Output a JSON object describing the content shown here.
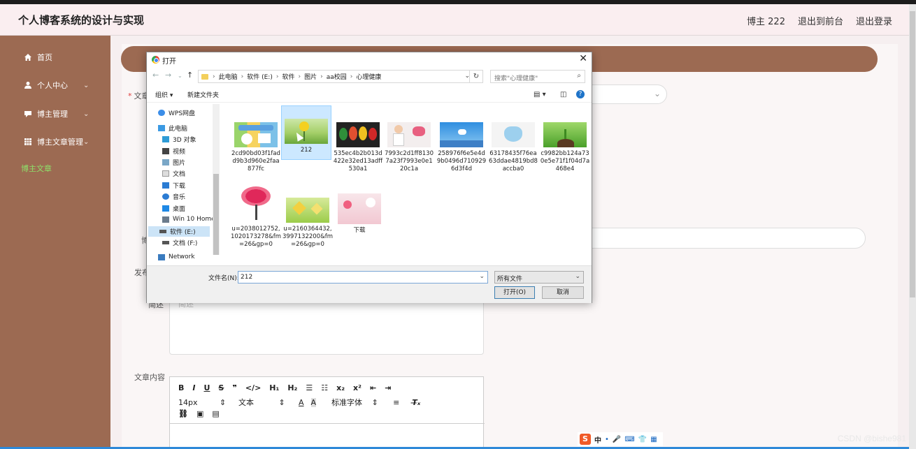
{
  "app": {
    "title": "个人博客系统的设计与实现",
    "header_links": [
      "博主 222",
      "退出到前台",
      "退出登录"
    ]
  },
  "sidebar": {
    "items": [
      {
        "label": "首页",
        "icon": "home-icon",
        "has_submenu": false
      },
      {
        "label": "个人中心",
        "icon": "user-icon",
        "has_submenu": true
      },
      {
        "label": "博主管理",
        "icon": "chat-icon",
        "has_submenu": true
      },
      {
        "label": "博主文章管理",
        "icon": "grid-icon",
        "has_submenu": true
      },
      {
        "label": "博主文章",
        "icon": "",
        "has_submenu": false,
        "active": true
      }
    ]
  },
  "form": {
    "labels": {
      "article": "文章",
      "blogger": "博",
      "publish": "发布",
      "summary": "简述",
      "content": "文章内容"
    },
    "summary_placeholder": "简述",
    "editor": {
      "row1": [
        "B",
        "I",
        "U",
        "S",
        "❞",
        "</>",
        "H₁",
        "H₂",
        "☰",
        "☷",
        "x₂",
        "x²",
        "⇤",
        "⇥"
      ],
      "font_size": "14px",
      "text_type": "文本",
      "font_family": "标准字体",
      "row3": [
        "🔗",
        "▣",
        "▤"
      ]
    }
  },
  "dialog": {
    "title": "打开",
    "breadcrumb": [
      "此电脑",
      "软件 (E:)",
      "软件",
      "图片",
      "aa校园",
      "心理健康"
    ],
    "search_placeholder": "搜索\"心理健康\"",
    "commands": {
      "organize": "组织 ▾",
      "new_folder": "新建文件夹"
    },
    "tree": [
      {
        "label": "WPS网盘",
        "icon": "cloud-icon"
      },
      {
        "label": "此电脑",
        "icon": "computer-icon"
      },
      {
        "label": "3D 对象",
        "icon": "cube-icon"
      },
      {
        "label": "视频",
        "icon": "video-icon"
      },
      {
        "label": "图片",
        "icon": "picture-icon"
      },
      {
        "label": "文档",
        "icon": "document-icon"
      },
      {
        "label": "下载",
        "icon": "download-icon"
      },
      {
        "label": "音乐",
        "icon": "music-icon"
      },
      {
        "label": "桌面",
        "icon": "desktop-icon"
      },
      {
        "label": "Win 10 Home",
        "icon": "drive-icon"
      },
      {
        "label": "软件 (E:)",
        "icon": "drive-icon",
        "selected": true
      },
      {
        "label": "文档 (F:)",
        "icon": "drive-icon"
      },
      {
        "label": "Network",
        "icon": "network-icon"
      }
    ],
    "files": [
      {
        "name": "2cd90bd03f1fadd9b3d960e2faa877fc",
        "thumb": "poster"
      },
      {
        "name": "212",
        "thumb": "smiley",
        "selected": true
      },
      {
        "name": "535ec4b2b013d422e32ed13adff530a1",
        "thumb": "masks"
      },
      {
        "name": "7993c2d1ff81307a23f7993e0e120c1a",
        "thumb": "doctor"
      },
      {
        "name": "258976f6e5e4d9b0496d7109296d3f4d",
        "thumb": "sky"
      },
      {
        "name": "63178435f76ea63ddae4819bd8accba0",
        "thumb": "heart-blue"
      },
      {
        "name": "c9982bb124a730e5e71f1f04d7a468e4",
        "thumb": "sprout"
      },
      {
        "name": "u=2038012752,1020173278&fm=26&gp=0",
        "thumb": "heart-tree"
      },
      {
        "name": "u=2160364432,3997132200&fm=26&gp=0",
        "thumb": "hearts-green"
      },
      {
        "name": "下载",
        "thumb": "pink"
      }
    ],
    "filename_label": "文件名(N):",
    "filename_value": "212",
    "filetype": "所有文件",
    "open_button": "打开(O)",
    "cancel_button": "取消"
  },
  "taskbar": {
    "ime_logo": "S",
    "ime_mode": "中",
    "watermark": "CSDN @bishe981"
  },
  "colors": {
    "sidebar_bg": "#9c6a52",
    "header_bg": "#faeef0",
    "active_menu": "#8ee06a",
    "selection": "#cce8ff"
  }
}
